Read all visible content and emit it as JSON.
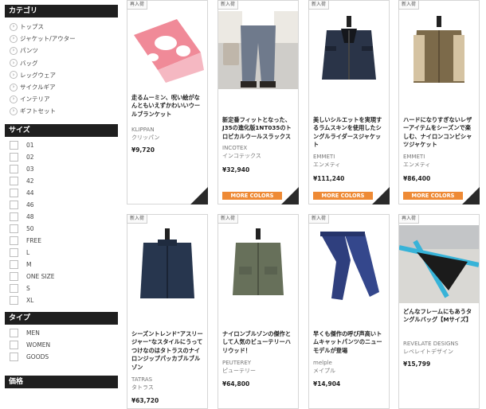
{
  "sidebar": {
    "category": {
      "heading": "カテゴリ",
      "items": [
        "トップス",
        "ジャケット/アウター",
        "パンツ",
        "バッグ",
        "レッグウェア",
        "サイクルギア",
        "インテリア",
        "ギフトセット"
      ]
    },
    "size": {
      "heading": "サイズ",
      "items": [
        "01",
        "02",
        "03",
        "42",
        "44",
        "46",
        "48",
        "50",
        "FREE",
        "L",
        "M",
        "ONE SIZE",
        "S",
        "XL"
      ]
    },
    "type": {
      "heading": "タイプ",
      "items": [
        "MEN",
        "WOMEN",
        "GOODS"
      ]
    },
    "price": {
      "heading": "価格"
    }
  },
  "products": [
    {
      "badge": "再入荷",
      "title": "走るムーミン、呪い絵がなんともいえずかわいいウールブランケット",
      "brand": "KLIPPAN",
      "brand_jp": "クリッパン",
      "price": "¥9,720",
      "more": ""
    },
    {
      "badge": "新入荷",
      "title": "新定番フィットとなった、J35の進化版1NT035のトロピカルウールスラックス",
      "brand": "INCOTEX",
      "brand_jp": "インコテックス",
      "price": "¥32,940",
      "more": "MORE COLORS"
    },
    {
      "badge": "新入荷",
      "title": "美しいシルエットを実現するラムスキンを使用したシングルライダースジャケット",
      "brand": "EMMETI",
      "brand_jp": "エンメティ",
      "price": "¥111,240",
      "more": "MORE COLORS"
    },
    {
      "badge": "新入荷",
      "title": "ハードになりすぎないレザーアイテムをシーズンで楽しむ、ナイロンコンビシャツジャケット",
      "brand": "EMMETI",
      "brand_jp": "エンメティ",
      "price": "¥86,400",
      "more": "MORE COLORS"
    },
    {
      "badge": "新入荷",
      "title": "シーズントレンド\"アスリージャー\"なスタイルにうってつけなのはタトラスのナイロンジップパッカブルブルゾン",
      "brand": "TATRAS",
      "brand_jp": "タトラス",
      "price": "¥63,720",
      "more": ""
    },
    {
      "badge": "新入荷",
      "title": "ナイロンブルゾンの傑作として人気のビューテリーハリウッド！",
      "brand": "PEUTEREY",
      "brand_jp": "ピューテリー",
      "price": "¥64,800",
      "more": ""
    },
    {
      "badge": "新入荷",
      "title": "早くも傑作の呼び声高いトムキャットパンツのニューモデルが登場",
      "brand": "melple",
      "brand_jp": "メイプル",
      "price": "¥14,904",
      "more": ""
    },
    {
      "badge": "再入荷",
      "title": "どんなフレームにもあうタングルバッグ【Mサイズ】",
      "brand": "REVELATE DESIGNS",
      "brand_jp": "レベレイトデザイン",
      "price": "¥15,799",
      "more": ""
    }
  ],
  "colors": {
    "accent": "#ee8a35",
    "header_bg": "#1f1f1f"
  }
}
